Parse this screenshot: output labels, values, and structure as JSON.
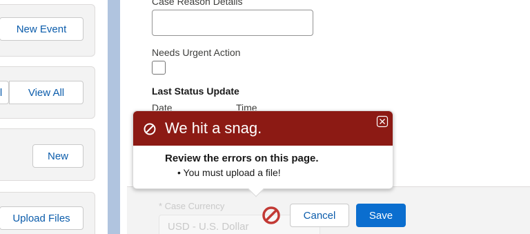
{
  "left_panel": {
    "cards": [
      {
        "button_label": "New Event"
      },
      {
        "partial_label": "l",
        "button_label": "View All"
      },
      {
        "button_label": "New"
      },
      {
        "button_label": "Upload Files"
      }
    ]
  },
  "form": {
    "case_reason_details_label": "Case Reason Details",
    "needs_urgent_action_label": "Needs Urgent Action",
    "last_status_update_title": "Last Status Update",
    "date_label": "Date",
    "time_label": "Time",
    "case_currency_label": "* Case Currency",
    "case_currency_value": "USD - U.S. Dollar"
  },
  "footer": {
    "cancel_label": "Cancel",
    "save_label": "Save"
  },
  "error_popover": {
    "title": "We hit a snag.",
    "heading": "Review the errors on this page.",
    "errors": [
      "You must upload a file!"
    ]
  },
  "colors": {
    "brand_blue": "#0b6ecf",
    "error_red": "#8c1a14",
    "link_blue": "#0b5cab"
  }
}
